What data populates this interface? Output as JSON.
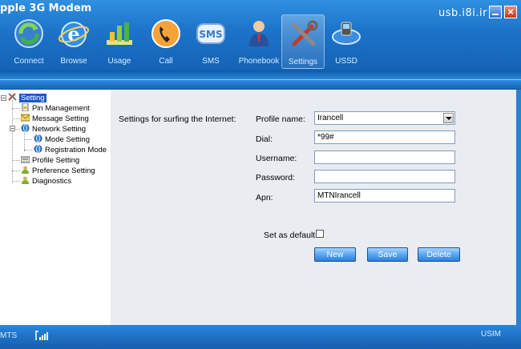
{
  "window": {
    "title": "pple 3G Modem",
    "site_label": "usb.i8i.ir",
    "minimize_label": "",
    "close_label": "×"
  },
  "toolbar": {
    "items": [
      {
        "label": "Connect",
        "icon": "connect-icon"
      },
      {
        "label": "Browse",
        "icon": "browse-icon"
      },
      {
        "label": "Usage",
        "icon": "usage-icon"
      },
      {
        "label": "Call",
        "icon": "call-icon"
      },
      {
        "label": "SMS",
        "icon": "sms-icon"
      },
      {
        "label": "Phonebook",
        "icon": "phonebook-icon"
      },
      {
        "label": "Settings",
        "icon": "settings-icon"
      },
      {
        "label": "USSD",
        "icon": "ussd-icon"
      }
    ],
    "active": "Settings",
    "sms_icon_text": "SMS"
  },
  "tree": {
    "root": "Setting",
    "items": [
      {
        "label": "Pin Management"
      },
      {
        "label": "Message Setting"
      },
      {
        "label": "Network Setting"
      },
      {
        "label": "Mode Setting"
      },
      {
        "label": "Registration Mode"
      },
      {
        "label": "Profile Setting"
      },
      {
        "label": "Preference Setting"
      },
      {
        "label": "Diagnostics"
      }
    ]
  },
  "form": {
    "section_title": "Settings for surfing the Internet:",
    "profile_name_label": "Profile name:",
    "profile_name_value": "Irancell",
    "dial_label": "Dial:",
    "dial_value": "*99#",
    "username_label": "Username:",
    "username_value": "",
    "password_label": "Password:",
    "password_value": "",
    "apn_label": "Apn:",
    "apn_value": "MTNIrancell",
    "set_default_label": "Set as default",
    "set_default_checked": false,
    "new_button": "New",
    "save_button": "Save",
    "delete_button": "Delete"
  },
  "status": {
    "network": "MTS",
    "sim": "USIM",
    "signal_icon": "signal-bars-icon"
  },
  "colors": {
    "accent": "#1c73c9",
    "selection": "#1e56c8",
    "button": "#5aa7f3"
  }
}
